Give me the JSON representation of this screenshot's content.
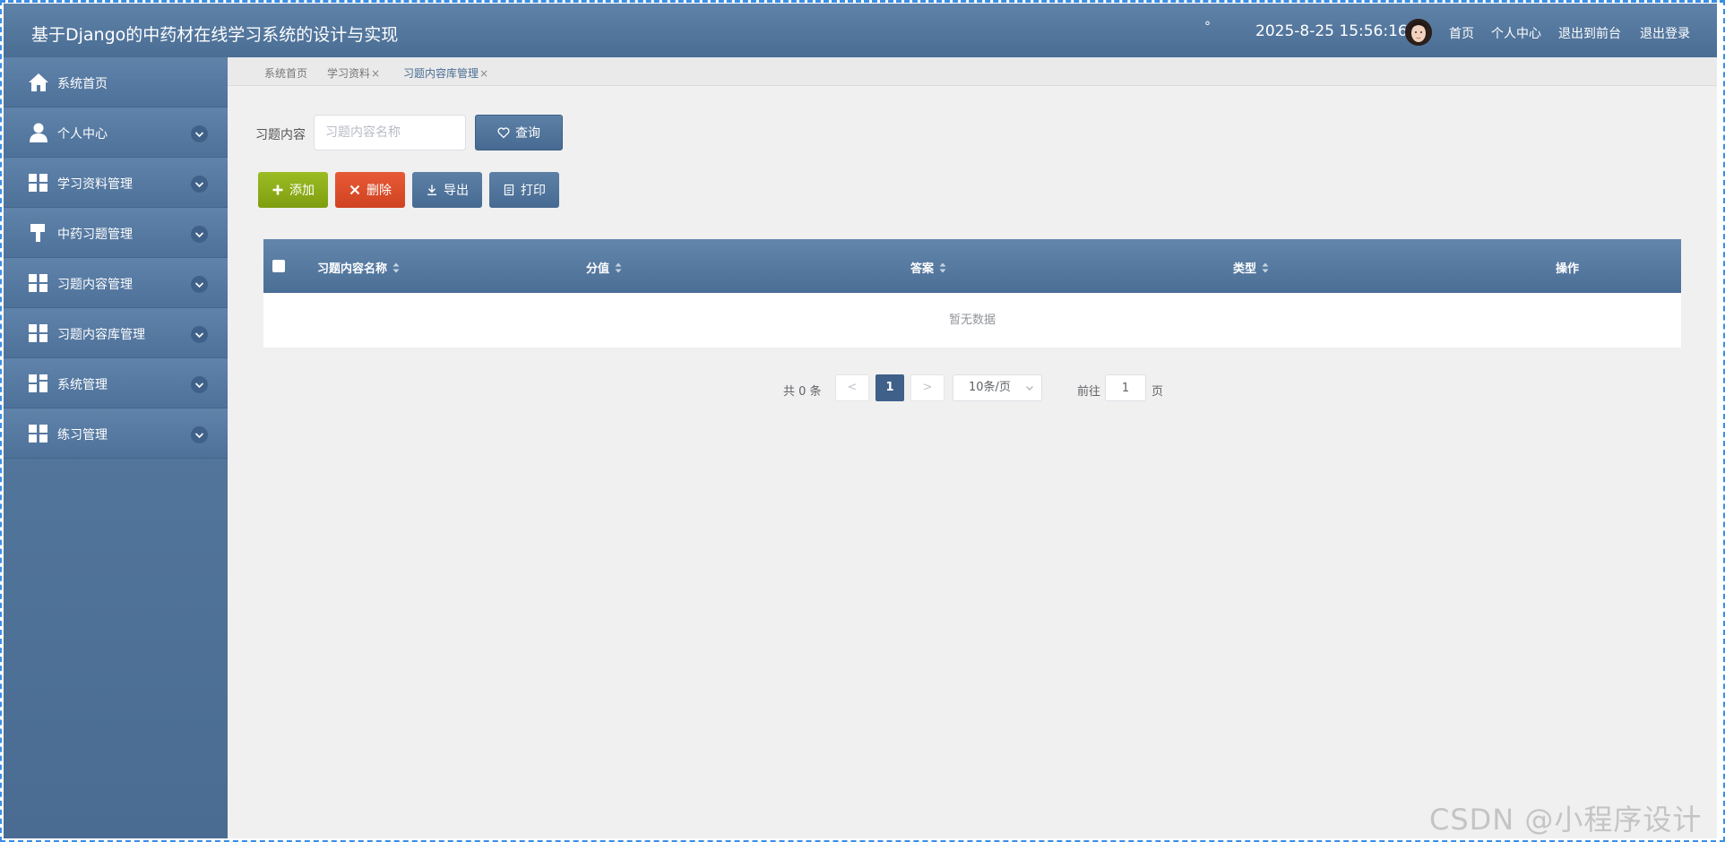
{
  "header": {
    "title": "基于Django的中药材在线学习系统的设计与实现",
    "degree": "°",
    "datetime": "2025-8-25 15:56:16",
    "nav": [
      "首页",
      "个人中心",
      "退出到前台",
      "退出登录"
    ]
  },
  "sidebar": {
    "items": [
      {
        "label": "系统首页",
        "icon": "home-icon",
        "expandable": false
      },
      {
        "label": "个人中心",
        "icon": "user-icon",
        "expandable": true
      },
      {
        "label": "学习资料管理",
        "icon": "grid-icon",
        "expandable": true
      },
      {
        "label": "中药习题管理",
        "icon": "brush-icon",
        "expandable": true
      },
      {
        "label": "习题内容管理",
        "icon": "grid-icon",
        "expandable": true
      },
      {
        "label": "习题内容库管理",
        "icon": "grid-icon",
        "expandable": true
      },
      {
        "label": "系统管理",
        "icon": "grid-icon",
        "expandable": true
      },
      {
        "label": "练习管理",
        "icon": "grid-icon",
        "expandable": true
      }
    ]
  },
  "tabs": [
    {
      "label": "系统首页",
      "closable": false,
      "active": false
    },
    {
      "label": "学习资料",
      "closable": true,
      "active": false
    },
    {
      "label": "习题内容库管理",
      "closable": true,
      "active": true
    }
  ],
  "tab_close": "×",
  "search": {
    "label": "习题内容",
    "placeholder": "习题内容名称",
    "query_label": "查询"
  },
  "actions": {
    "add": "添加",
    "delete": "删除",
    "export": "导出",
    "print": "打印"
  },
  "table": {
    "columns": [
      "习题内容名称",
      "分值",
      "答案",
      "类型",
      "操作"
    ],
    "empty_text": "暂无数据"
  },
  "pagination": {
    "total": "共 0 条",
    "prev": "<",
    "next": ">",
    "current_page": "1",
    "page_size": "10条/页",
    "jump_label": "前往",
    "jump_value": "1",
    "jump_suffix": "页"
  },
  "watermark": "CSDN @小程序设计",
  "colors": {
    "header": "#4a6d94",
    "add": "#8bab19",
    "delete": "#dc4e2b",
    "primary": "#4f7299"
  }
}
